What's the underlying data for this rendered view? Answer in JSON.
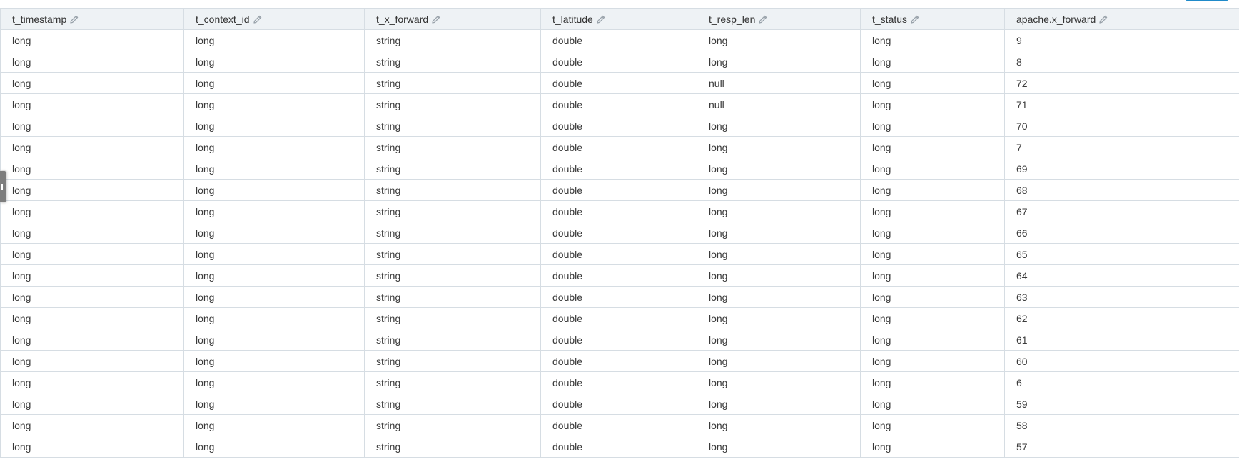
{
  "columns": [
    {
      "label": "t_timestamp",
      "editable": true
    },
    {
      "label": "t_context_id",
      "editable": true
    },
    {
      "label": "t_x_forward",
      "editable": true
    },
    {
      "label": "t_latitude",
      "editable": true
    },
    {
      "label": "t_resp_len",
      "editable": true
    },
    {
      "label": "t_status",
      "editable": true
    },
    {
      "label": "apache.x_forward",
      "editable": true
    }
  ],
  "rows": [
    [
      "long",
      "long",
      "string",
      "double",
      "long",
      "long",
      "9"
    ],
    [
      "long",
      "long",
      "string",
      "double",
      "long",
      "long",
      "8"
    ],
    [
      "long",
      "long",
      "string",
      "double",
      "null",
      "long",
      "72"
    ],
    [
      "long",
      "long",
      "string",
      "double",
      "null",
      "long",
      "71"
    ],
    [
      "long",
      "long",
      "string",
      "double",
      "long",
      "long",
      "70"
    ],
    [
      "long",
      "long",
      "string",
      "double",
      "long",
      "long",
      "7"
    ],
    [
      "long",
      "long",
      "string",
      "double",
      "long",
      "long",
      "69"
    ],
    [
      "long",
      "long",
      "string",
      "double",
      "long",
      "long",
      "68"
    ],
    [
      "long",
      "long",
      "string",
      "double",
      "long",
      "long",
      "67"
    ],
    [
      "long",
      "long",
      "string",
      "double",
      "long",
      "long",
      "66"
    ],
    [
      "long",
      "long",
      "string",
      "double",
      "long",
      "long",
      "65"
    ],
    [
      "long",
      "long",
      "string",
      "double",
      "long",
      "long",
      "64"
    ],
    [
      "long",
      "long",
      "string",
      "double",
      "long",
      "long",
      "63"
    ],
    [
      "long",
      "long",
      "string",
      "double",
      "long",
      "long",
      "62"
    ],
    [
      "long",
      "long",
      "string",
      "double",
      "long",
      "long",
      "61"
    ],
    [
      "long",
      "long",
      "string",
      "double",
      "long",
      "long",
      "60"
    ],
    [
      "long",
      "long",
      "string",
      "double",
      "long",
      "long",
      "6"
    ],
    [
      "long",
      "long",
      "string",
      "double",
      "long",
      "long",
      "59"
    ],
    [
      "long",
      "long",
      "string",
      "double",
      "long",
      "long",
      "58"
    ],
    [
      "long",
      "long",
      "string",
      "double",
      "long",
      "long",
      "57"
    ]
  ],
  "icons": {
    "header_edit": "pencil-icon",
    "side_handle": "panel-resize-handle"
  },
  "colors": {
    "header_background": "#eef2f5",
    "border": "#d6dde3",
    "pencil": "#9aa3ab",
    "accent": "#1f8ac9"
  }
}
